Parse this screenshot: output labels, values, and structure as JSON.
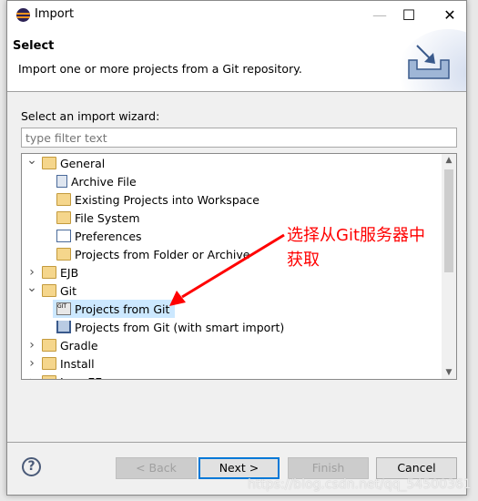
{
  "window": {
    "title": "Import",
    "minimize": "—",
    "maximize": "☐",
    "close": "✕"
  },
  "header": {
    "title": "Select",
    "description": "Import one or more projects from a Git repository."
  },
  "wizard_label": "Select an import wizard:",
  "filter": {
    "placeholder": "type filter text",
    "value": ""
  },
  "tree": [
    {
      "label": "General",
      "level": 0,
      "expanded": true,
      "icon": "folder-open-icon"
    },
    {
      "label": "Archive File",
      "level": 1,
      "icon": "archive-file-icon"
    },
    {
      "label": "Existing Projects into Workspace",
      "level": 1,
      "icon": "existing-projects-icon"
    },
    {
      "label": "File System",
      "level": 1,
      "icon": "folder-icon"
    },
    {
      "label": "Preferences",
      "level": 1,
      "icon": "preferences-icon"
    },
    {
      "label": "Projects from Folder or Archive",
      "level": 1,
      "icon": "folder-icon"
    },
    {
      "label": "EJB",
      "level": 0,
      "expanded": false,
      "icon": "folder-open-icon"
    },
    {
      "label": "Git",
      "level": 0,
      "expanded": true,
      "icon": "folder-open-icon"
    },
    {
      "label": "Projects from Git",
      "level": 1,
      "icon": "git-icon",
      "selected": true
    },
    {
      "label": "Projects from Git (with smart import)",
      "level": 1,
      "icon": "smart-import-icon"
    },
    {
      "label": "Gradle",
      "level": 0,
      "expanded": false,
      "icon": "folder-open-icon"
    },
    {
      "label": "Install",
      "level": 0,
      "expanded": false,
      "icon": "folder-open-icon"
    },
    {
      "label": "Java EE",
      "level": 0,
      "expanded": false,
      "icon": "folder-open-icon"
    }
  ],
  "buttons": {
    "help": "?",
    "back": "< Back",
    "next": "Next >",
    "finish": "Finish",
    "cancel": "Cancel"
  },
  "annotation": {
    "line1": "选择从Git服务器中",
    "line2": "获取",
    "color": "#ff0000"
  },
  "watermark": "https://blog.csdn.net/qq_54500361"
}
